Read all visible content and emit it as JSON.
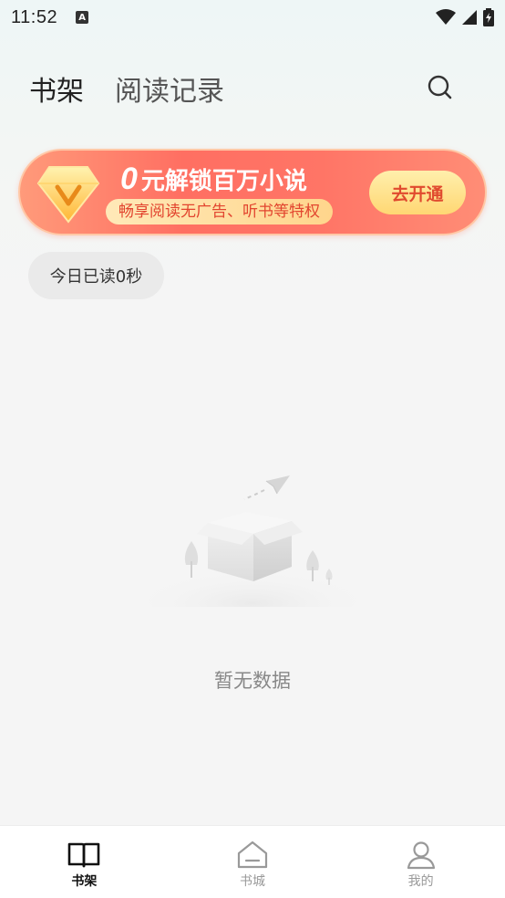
{
  "status_bar": {
    "time": "11:52",
    "notification_icon": "a-icon"
  },
  "header": {
    "tabs": [
      {
        "label": "书架",
        "active": true
      },
      {
        "label": "阅读记录",
        "active": false
      }
    ],
    "search_icon": "search-icon"
  },
  "vip_banner": {
    "title_zero": "0",
    "title_rest": "元解锁百万小说",
    "subtitle": "畅享阅读无广告、听书等特权",
    "button_label": "去开通",
    "accent_color": "#ff6f62"
  },
  "today_read": {
    "label": "今日已读0秒"
  },
  "empty_state": {
    "text": "暂无数据"
  },
  "bottom_nav": {
    "items": [
      {
        "label": "书架",
        "icon": "book-icon",
        "active": true
      },
      {
        "label": "书城",
        "icon": "house-icon",
        "active": false
      },
      {
        "label": "我的",
        "icon": "person-icon",
        "active": false
      }
    ]
  }
}
